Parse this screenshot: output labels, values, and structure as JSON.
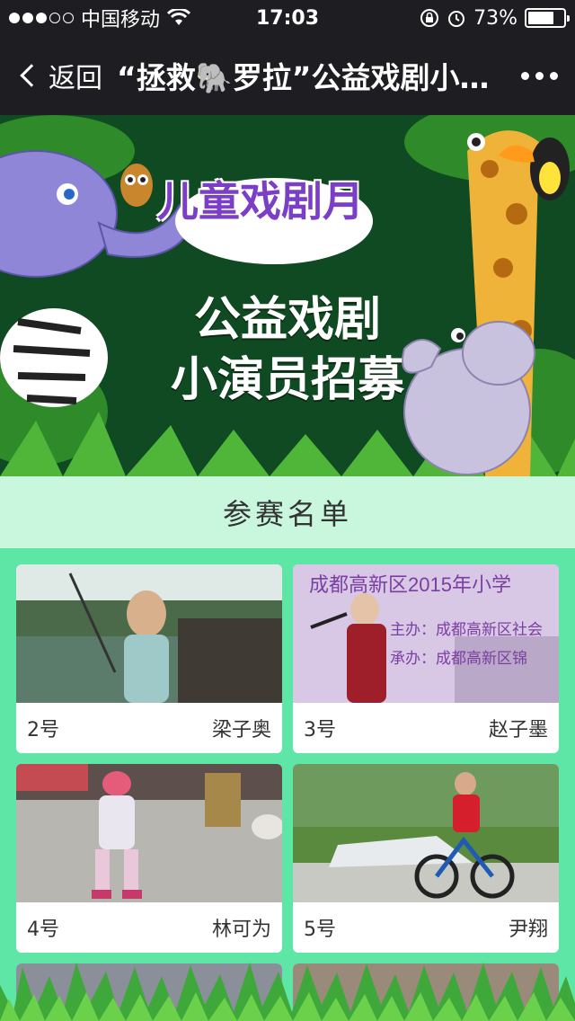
{
  "status_bar": {
    "carrier": "中国移动",
    "time": "17:03",
    "battery": "73%",
    "battery_level": 0.73,
    "signal_bars_on": 3,
    "signal_bars_total": 5
  },
  "nav": {
    "back_label": "返回",
    "title": "“拯救🐘罗拉”公益戏剧小演员招募"
  },
  "banner": {
    "subtitle": "儿童戏剧月",
    "title_line1": "公益戏剧",
    "title_line2": "小演员招募"
  },
  "section": {
    "title": "参赛名单"
  },
  "contestants": [
    {
      "number": "2号",
      "name": "梁子奥"
    },
    {
      "number": "3号",
      "name": "赵子墨"
    },
    {
      "number": "4号",
      "name": "林可为"
    },
    {
      "number": "5号",
      "name": "尹翔"
    }
  ],
  "photo_captions": {
    "card2_line1": "成都高新区2015年小学",
    "card2_line2": "主办：成都高新区社会",
    "card2_line3": "承办：成都高新区锦"
  },
  "colors": {
    "page_bg": "#5ee6a6",
    "section_bg": "#c9f7de",
    "bar_bg": "#1e1e22"
  }
}
